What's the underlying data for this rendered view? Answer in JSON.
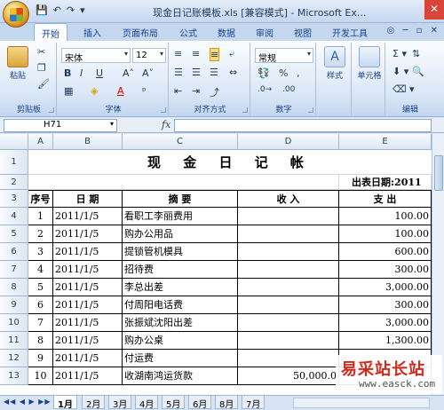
{
  "window": {
    "title": "现金日记账模板.xls [兼容模式] - Microsoft Ex...",
    "close_glyph": "✕"
  },
  "qat": {
    "save": "💾",
    "undo": "↶",
    "redo": "↷",
    "dropdown": "▾"
  },
  "ribbon": {
    "tabs": [
      "开始",
      "插入",
      "页面布局",
      "公式",
      "数据",
      "审阅",
      "视图",
      "开发工具"
    ],
    "active_tab": "开始",
    "groups": {
      "clipboard": {
        "label": "剪贴板",
        "paste": "粘贴"
      },
      "font": {
        "label": "字体",
        "font_name": "宋体",
        "font_size": "12"
      },
      "alignment": {
        "label": "对齐方式"
      },
      "number": {
        "label": "数字",
        "format": "常规"
      },
      "styles": {
        "label": "样式"
      },
      "cells": {
        "label": "单元格"
      },
      "editing": {
        "label": "编辑"
      }
    }
  },
  "formula_bar": {
    "name_box": "H71",
    "fx": "fx",
    "formula": ""
  },
  "sheet": {
    "columns": [
      "A",
      "B",
      "C",
      "D",
      "E"
    ],
    "row_numbers": [
      "1",
      "2",
      "3",
      "4",
      "5",
      "6",
      "7",
      "8",
      "9",
      "10",
      "11",
      "12",
      "13"
    ],
    "title": "现 金 日 记 帐",
    "date_label": "出表日期:2011",
    "headers": {
      "seq": "序号",
      "date": "日 期",
      "desc": "摘 要",
      "income": "收 入",
      "expense": "支 出"
    },
    "rows": [
      {
        "seq": "1",
        "date": "2011/1/5",
        "desc": "看职工李丽费用",
        "income": "",
        "expense": "100.00"
      },
      {
        "seq": "2",
        "date": "2011/1/5",
        "desc": "购办公用品",
        "income": "",
        "expense": "100.00"
      },
      {
        "seq": "3",
        "date": "2011/1/5",
        "desc": "提锁管机模具",
        "income": "",
        "expense": "600.00"
      },
      {
        "seq": "4",
        "date": "2011/1/5",
        "desc": "招待费",
        "income": "",
        "expense": "300.00"
      },
      {
        "seq": "5",
        "date": "2011/1/5",
        "desc": "李总出差",
        "income": "",
        "expense": "3,000.00"
      },
      {
        "seq": "6",
        "date": "2011/1/5",
        "desc": "付周阳电话费",
        "income": "",
        "expense": "300.00"
      },
      {
        "seq": "7",
        "date": "2011/1/5",
        "desc": "张振斌沈阳出差",
        "income": "",
        "expense": "3,000.00"
      },
      {
        "seq": "8",
        "date": "2011/1/5",
        "desc": "购办公桌",
        "income": "",
        "expense": "1,300.00"
      },
      {
        "seq": "9",
        "date": "2011/1/5",
        "desc": "付运费",
        "income": "",
        "expense": ""
      },
      {
        "seq": "10",
        "date": "2011/1/5",
        "desc": "收湖南鸿运货款",
        "income": "50,000.0",
        "expense": ""
      }
    ]
  },
  "sheet_tabs": [
    "1月",
    "2月",
    "3月",
    "4月",
    "5月",
    "6月",
    "8月",
    "7月"
  ],
  "active_sheet": "1月",
  "watermark": {
    "title": "易采站长站",
    "url": "www.easck.com"
  }
}
